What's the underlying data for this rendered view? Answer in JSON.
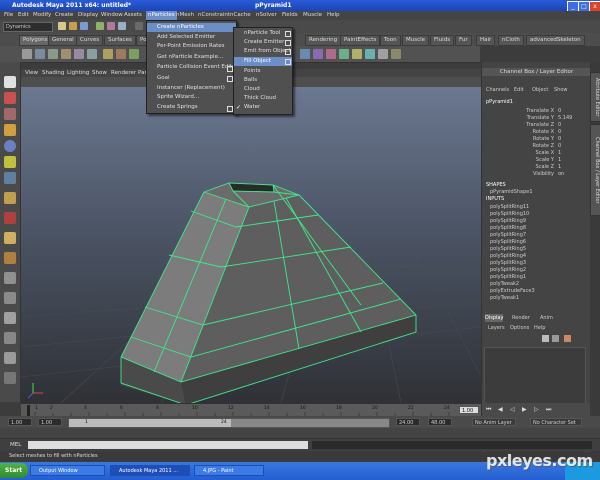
{
  "title_bar": {
    "title": "Autodesk Maya 2011 x64: untitled*",
    "context": "pPyramid1",
    "min": "_",
    "max": "□",
    "close": "x"
  },
  "menus": [
    "File",
    "Edit",
    "Modify",
    "Create",
    "Display",
    "Window",
    "Assets",
    "nParticles",
    "nMesh",
    "nConstraint",
    "nCache",
    "nSolver",
    "Fields",
    "Muscle",
    "Help"
  ],
  "menu_set": "Dynamics",
  "shelf_tabs": [
    "Polygons",
    "General",
    "Curves",
    "Surfaces",
    "Pol",
    "Rendering",
    "PaintEffects",
    "Toon",
    "Muscle",
    "Fluids",
    "Fur",
    "Hair",
    "nCloth",
    "advancedSkeleton"
  ],
  "viewport_menu": [
    "View",
    "Shading",
    "Lighting",
    "Show",
    "Renderer",
    "Panels"
  ],
  "nparticles_menu": {
    "items": [
      "Create nParticles",
      "Add Selected Emitter",
      "Per-Point Emission Rates",
      "Get nParticle Example...",
      "Particle Collision Event Editor",
      "Goal",
      "Instancer (Replacement)",
      "Sprite Wizard...",
      "Create Springs"
    ],
    "highlighted": "Create nParticles"
  },
  "create_nparticles_submenu": {
    "items": [
      "nParticle Tool",
      "Create Emitter",
      "Emit from Object",
      "Fill Object",
      "Points",
      "Balls",
      "Cloud",
      "Thick Cloud",
      "Water"
    ],
    "highlighted": "Fill Object",
    "checked": "Water"
  },
  "channel_box": {
    "header": "Channel Box / Layer Editor",
    "menu": [
      "Channels",
      "Edit",
      "Object",
      "Show"
    ],
    "object": "pPyramid1",
    "attributes": [
      {
        "name": "Translate X",
        "value": "0"
      },
      {
        "name": "Translate Y",
        "value": "5.149"
      },
      {
        "name": "Translate Z",
        "value": "0"
      },
      {
        "name": "Rotate X",
        "value": "0"
      },
      {
        "name": "Rotate Y",
        "value": "0"
      },
      {
        "name": "Rotate Z",
        "value": "0"
      },
      {
        "name": "Scale X",
        "value": "1"
      },
      {
        "name": "Scale Y",
        "value": "1"
      },
      {
        "name": "Scale Z",
        "value": "1"
      },
      {
        "name": "Visibility",
        "value": "on"
      }
    ],
    "shapes_label": "SHAPES",
    "shape": "pPyramidShape1",
    "inputs_label": "INPUTS",
    "inputs": [
      "polySplitRing11",
      "polySplitRing10",
      "polySplitRing9",
      "polySplitRing8",
      "polySplitRing7",
      "polySplitRing6",
      "polySplitRing5",
      "polySplitRing4",
      "polySplitRing3",
      "polySplitRing2",
      "polySplitRing1",
      "polyTweak2",
      "polyExtrudeFace3",
      "polyTweak1"
    ]
  },
  "layer_editor": {
    "tabs": [
      "Display",
      "Render",
      "Anim"
    ],
    "menu": [
      "Layers",
      "Options",
      "Help"
    ]
  },
  "side_tabs": [
    "Attribute Editor",
    "Channel Box / Layer Editor"
  ],
  "timeline": {
    "ticks": [
      "1",
      "2",
      "4",
      "6",
      "8",
      "10",
      "12",
      "14",
      "16",
      "18",
      "20",
      "22",
      "24"
    ],
    "current": "1.00"
  },
  "range": {
    "start": "1.00",
    "start2": "1.00",
    "slider_start": "1",
    "slider_end": "24",
    "end": "24.00",
    "end2": "48.00",
    "anim_layer": "No Anim Layer",
    "character_set": "No Character Set"
  },
  "mel_label": "MEL",
  "status_text": "Select meshes to fill with nParticles",
  "taskbar": {
    "start": "Start",
    "items": [
      "Output Window",
      "Autodesk Maya 2011 ...",
      "4.JPG - Paint"
    ],
    "clock": ""
  },
  "watermark": "pxleyes.com"
}
